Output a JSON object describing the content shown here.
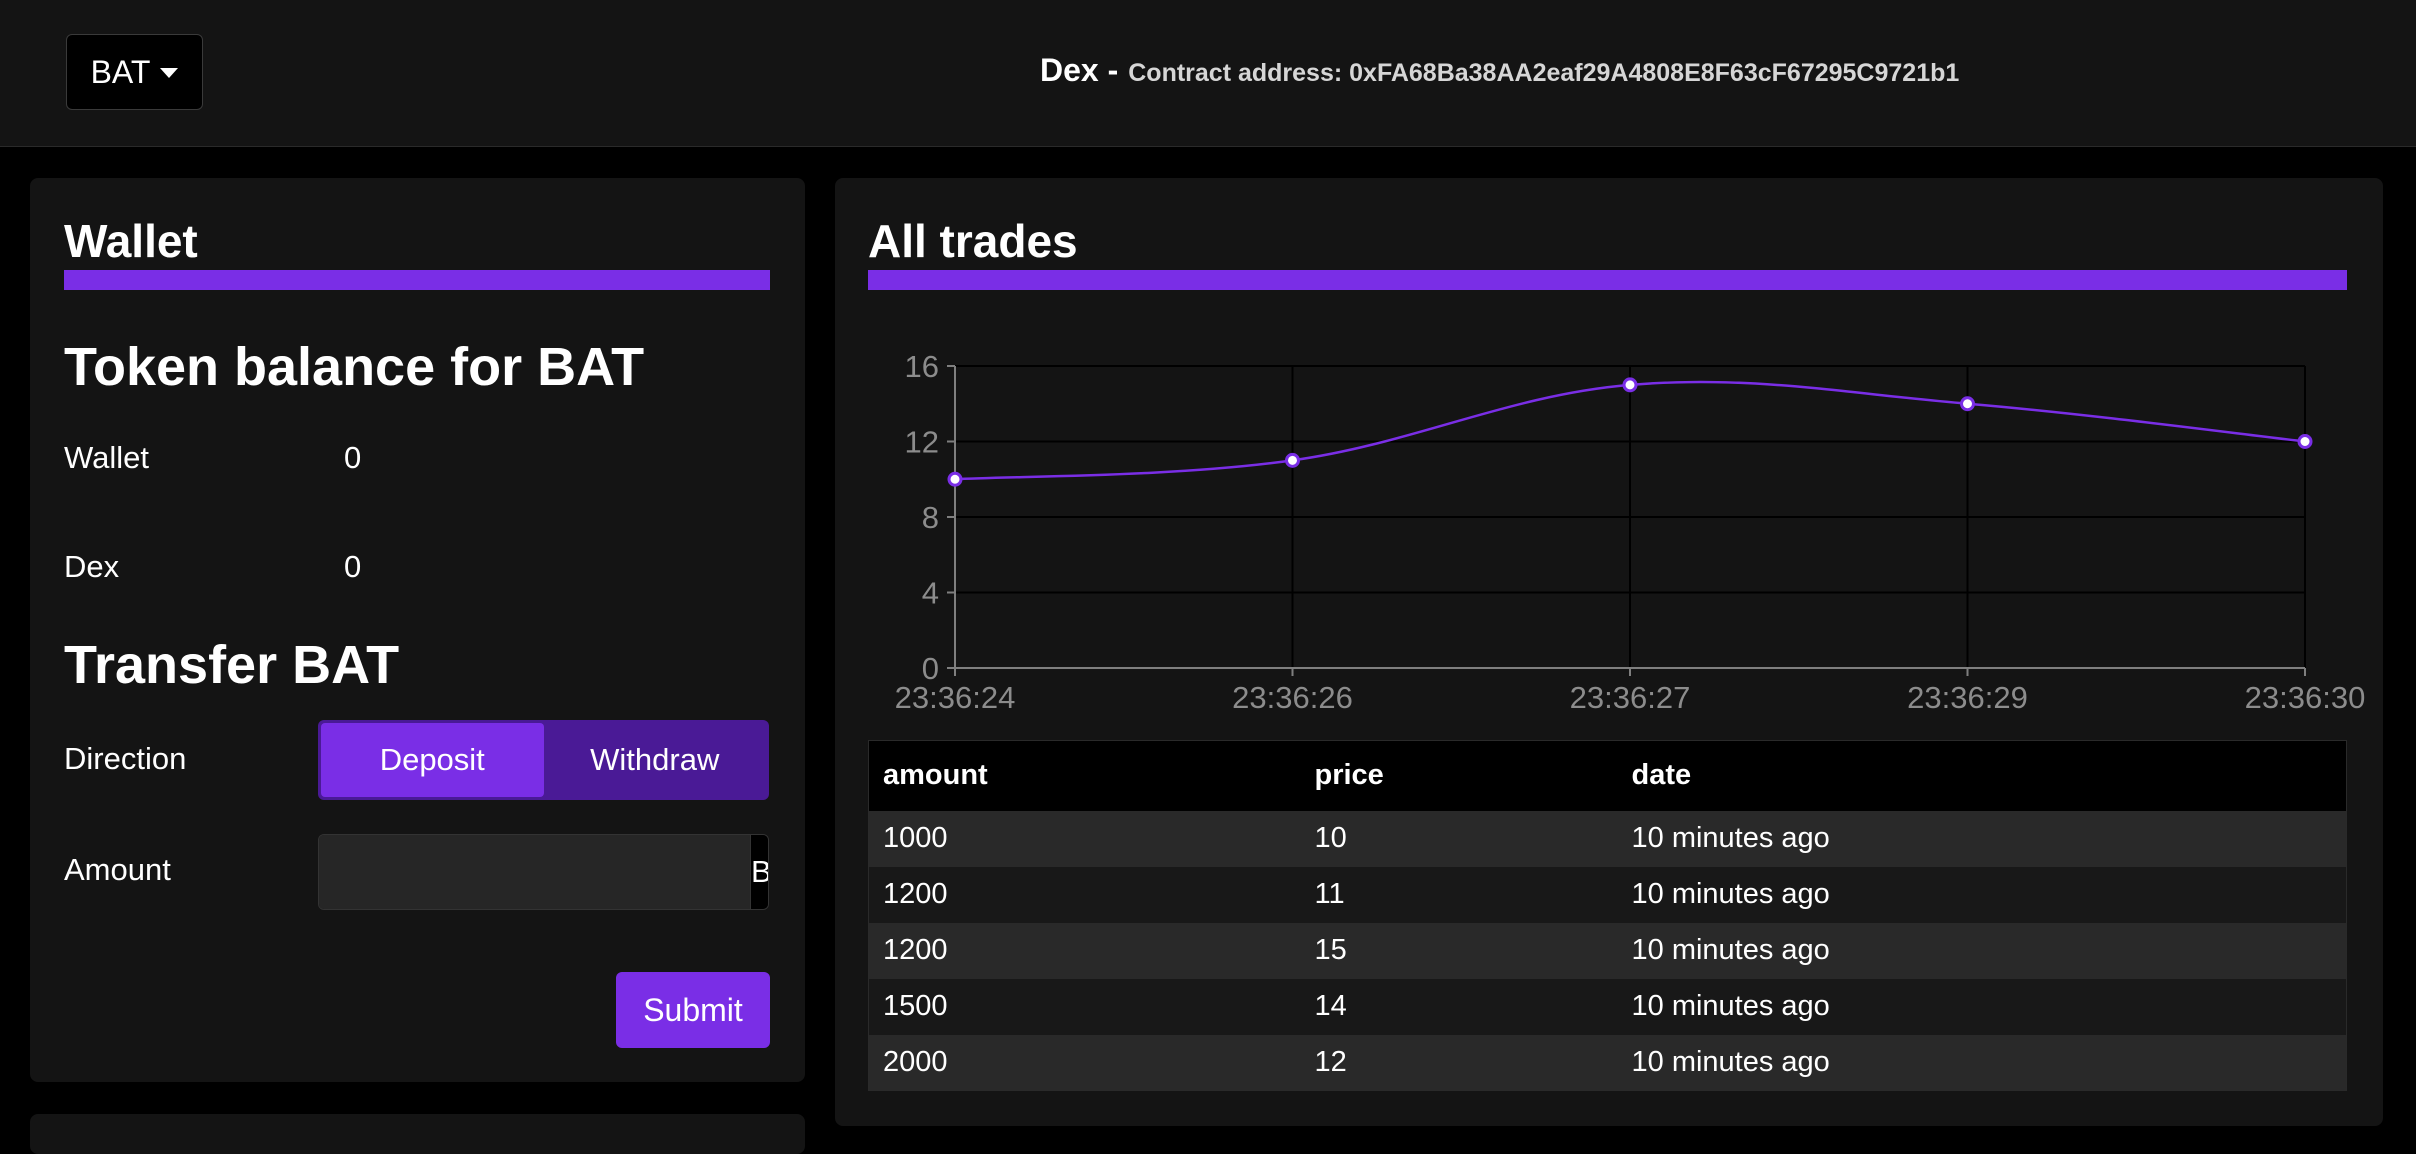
{
  "header": {
    "token_selected": "BAT",
    "brand": "Dex -",
    "contract_text": "Contract address: 0xFA68Ba38AA2eaf29A4808E8F63cF67295C9721b1"
  },
  "wallet": {
    "title": "Wallet",
    "balance_heading": "Token balance for BAT",
    "balances": [
      {
        "label": "Wallet",
        "value": "0"
      },
      {
        "label": "Dex",
        "value": "0"
      }
    ],
    "transfer_heading": "Transfer BAT",
    "direction_label": "Direction",
    "direction_options": [
      "Deposit",
      "Withdraw"
    ],
    "direction_selected": "Deposit",
    "amount_label": "Amount",
    "amount_value": "",
    "amount_placeholder": "",
    "amount_unit": "BAT",
    "submit_label": "Submit"
  },
  "trades": {
    "title": "All trades",
    "columns": [
      "amount",
      "price",
      "date"
    ],
    "rows": [
      {
        "amount": "1000",
        "price": "10",
        "date": "10 minutes ago"
      },
      {
        "amount": "1200",
        "price": "11",
        "date": "10 minutes ago"
      },
      {
        "amount": "1200",
        "price": "15",
        "date": "10 minutes ago"
      },
      {
        "amount": "1500",
        "price": "14",
        "date": "10 minutes ago"
      },
      {
        "amount": "2000",
        "price": "12",
        "date": "10 minutes ago"
      }
    ]
  },
  "chart_data": {
    "type": "line",
    "title": "",
    "xlabel": "",
    "ylabel": "",
    "x": [
      "23:36:24",
      "23:36:26",
      "23:36:27",
      "23:36:29",
      "23:36:30"
    ],
    "series": [
      {
        "values": [
          10,
          11,
          15,
          14,
          12
        ]
      }
    ],
    "ylim": [
      0,
      16
    ],
    "yticks": [
      0,
      4,
      8,
      12,
      16
    ],
    "grid": true,
    "colors": {
      "line": "#7a2ee6",
      "grid": "#000000",
      "axis": "#7f7f7f",
      "tick_label": "#8c8c8c"
    }
  },
  "colors": {
    "accent": "#7a2ee6",
    "background": "#000000",
    "card": "#141414"
  }
}
